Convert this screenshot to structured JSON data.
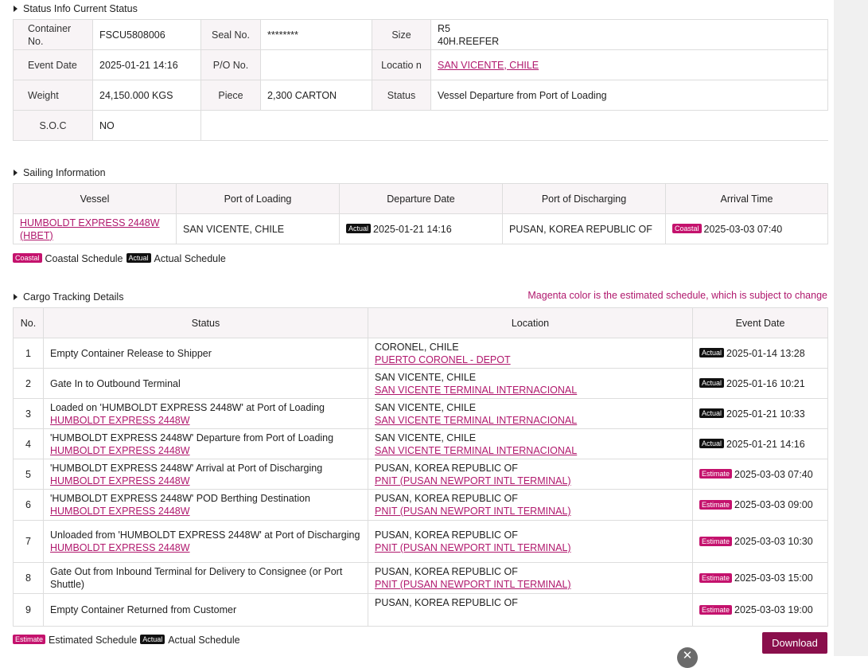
{
  "status_section": {
    "title": "Status Info Current Status",
    "labels": {
      "container_no": "Container No.",
      "seal_no": "Seal No.",
      "size": "Size",
      "event_date": "Event Date",
      "po_no": "P/O No.",
      "location": "Locatio n",
      "weight": "Weight",
      "piece": "Piece",
      "status": "Status",
      "soc": "S.O.C"
    },
    "values": {
      "container_no": "FSCU5808006",
      "seal_no": "********",
      "size_line1": "R5",
      "size_line2": "40H.REEFER",
      "event_date": "2025-01-21 14:16",
      "po_no": "",
      "location": "SAN VICENTE, CHILE",
      "weight": "24,150.000 KGS",
      "piece": "2,300 CARTON",
      "status": "Vessel Departure from Port of Loading",
      "soc": "NO"
    }
  },
  "sailing_section": {
    "title": "Sailing Information",
    "headers": [
      "Vessel",
      "Port of Loading",
      "Departure Date",
      "Port of Discharging",
      "Arrival Time"
    ],
    "row": {
      "vessel": "HUMBOLDT EXPRESS 2448W (HBET)",
      "port_of_loading": "SAN VICENTE, CHILE",
      "departure_badge": "Actual",
      "departure_date": "2025-01-21 14:16",
      "port_of_discharging": "PUSAN, KOREA REPUBLIC OF",
      "arrival_badge": "Coastal",
      "arrival_time": "2025-03-03 07:40"
    },
    "legend": {
      "coastal_badge": "Coastal",
      "coastal_text": "Coastal Schedule",
      "actual_badge": "Actual",
      "actual_text": "Actual Schedule"
    }
  },
  "cargo_section": {
    "title": "Cargo Tracking Details",
    "note": "Magenta color is the estimated schedule, which is subject to change",
    "headers": [
      "No.",
      "Status",
      "Location",
      "Event Date"
    ],
    "rows": [
      {
        "no": "1",
        "status": "Empty Container Release to Shipper",
        "status_link": "",
        "location": "CORONEL, CHILE",
        "location_link": "PUERTO CORONEL - DEPOT",
        "badge": "Actual",
        "date": "2025-01-14 13:28"
      },
      {
        "no": "2",
        "status": "Gate In to Outbound Terminal",
        "status_link": "",
        "location": "SAN VICENTE, CHILE",
        "location_link": "SAN VICENTE TERMINAL INTERNACIONAL",
        "badge": "Actual",
        "date": "2025-01-16 10:21"
      },
      {
        "no": "3",
        "status": "Loaded on 'HUMBOLDT EXPRESS 2448W' at Port of Loading",
        "status_link": "HUMBOLDT EXPRESS 2448W",
        "location": "SAN VICENTE, CHILE",
        "location_link": "SAN VICENTE TERMINAL INTERNACIONAL",
        "badge": "Actual",
        "date": "2025-01-21 10:33"
      },
      {
        "no": "4",
        "status": "'HUMBOLDT EXPRESS 2448W' Departure from Port of Loading",
        "status_link": "HUMBOLDT EXPRESS 2448W",
        "location": "SAN VICENTE, CHILE",
        "location_link": "SAN VICENTE TERMINAL INTERNACIONAL",
        "badge": "Actual",
        "date": "2025-01-21 14:16"
      },
      {
        "no": "5",
        "status": "'HUMBOLDT EXPRESS 2448W' Arrival at Port of Discharging",
        "status_link": "HUMBOLDT EXPRESS 2448W",
        "location": "PUSAN, KOREA REPUBLIC OF",
        "location_link": "PNIT (PUSAN NEWPORT INTL TERMINAL)",
        "badge": "Estimate",
        "date": "2025-03-03 07:40"
      },
      {
        "no": "6",
        "status": "'HUMBOLDT EXPRESS 2448W' POD Berthing Destination",
        "status_link": "HUMBOLDT EXPRESS 2448W",
        "location": "PUSAN, KOREA REPUBLIC OF",
        "location_link": "PNIT (PUSAN NEWPORT INTL TERMINAL)",
        "badge": "Estimate",
        "date": "2025-03-03 09:00"
      },
      {
        "no": "7",
        "status": "Unloaded from 'HUMBOLDT EXPRESS 2448W' at Port of Discharging",
        "status_link": "HUMBOLDT EXPRESS 2448W",
        "location": "PUSAN, KOREA REPUBLIC OF",
        "location_link": "PNIT (PUSAN NEWPORT INTL TERMINAL)",
        "badge": "Estimate",
        "date": "2025-03-03 10:30"
      },
      {
        "no": "8",
        "status": "Gate Out from Inbound Terminal for Delivery to Consignee (or Port Shuttle)",
        "status_link": "",
        "location": "PUSAN, KOREA REPUBLIC OF",
        "location_link": "PNIT (PUSAN NEWPORT INTL TERMINAL)",
        "badge": "Estimate",
        "date": "2025-03-03 15:00"
      },
      {
        "no": "9",
        "status": "Empty Container Returned from Customer",
        "status_link": "",
        "location": "PUSAN, KOREA REPUBLIC OF",
        "location_link": "",
        "badge": "Estimate",
        "date": "2025-03-03 19:00"
      }
    ],
    "legend": {
      "estimate_badge": "Estimate",
      "estimate_text": "Estimated Schedule",
      "actual_badge": "Actual",
      "actual_text": "Actual Schedule"
    }
  },
  "actions": {
    "download_label": "Download",
    "close_glyph": "✕"
  },
  "colors": {
    "accent": "#b0186d",
    "estimate_badge": "#c4126d",
    "actual_badge": "#111111",
    "download_button": "#8a0f4c"
  }
}
